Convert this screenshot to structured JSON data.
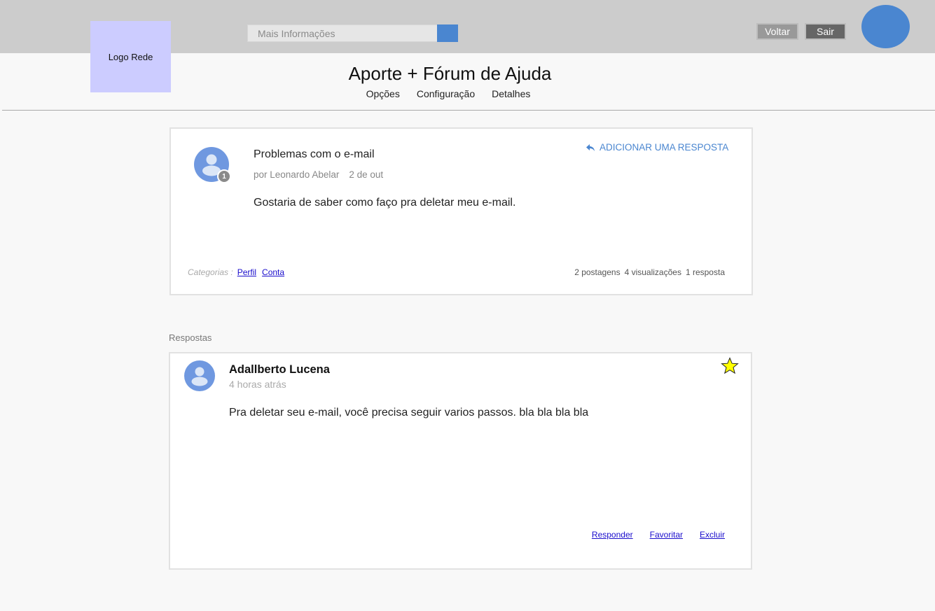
{
  "header": {
    "logo": "Logo Rede",
    "search": {
      "placeholder": "Mais Informações",
      "value": ""
    },
    "back_label": "Voltar",
    "exit_label": "Sair",
    "accent": "#4a86d0"
  },
  "page": {
    "title": "Aporte + Fórum de Ajuda",
    "nav": [
      "Opções",
      "Configuração",
      "Detalhes"
    ]
  },
  "post": {
    "title": "Problemas com o e-mail",
    "author": "por Leonardo Abelar",
    "date": "2 de out",
    "badge": "1",
    "body": "Gostaria de saber como faço pra deletar meu e-mail.",
    "reply_action": "ADICIONAR UMA RESPOSTA",
    "categories_label": "Categorias :",
    "categories": [
      "Perfil",
      "Conta"
    ],
    "stats": [
      "2 postagens",
      "4 visualizações",
      "1 resposta"
    ]
  },
  "answers_label": "Respostas",
  "answer": {
    "author": "Adallberto Lucena",
    "time": "4 horas atrás",
    "body": "Pra deletar seu e-mail, você precisa seguir varios passos. bla bla bla bla",
    "actions": [
      "Responder",
      "Favoritar",
      "Excluir"
    ]
  },
  "icons": {
    "search_button": "search-icon",
    "reply": "reply-arrow-icon",
    "favorite": "star-icon",
    "avatar": "user-avatar-icon"
  }
}
